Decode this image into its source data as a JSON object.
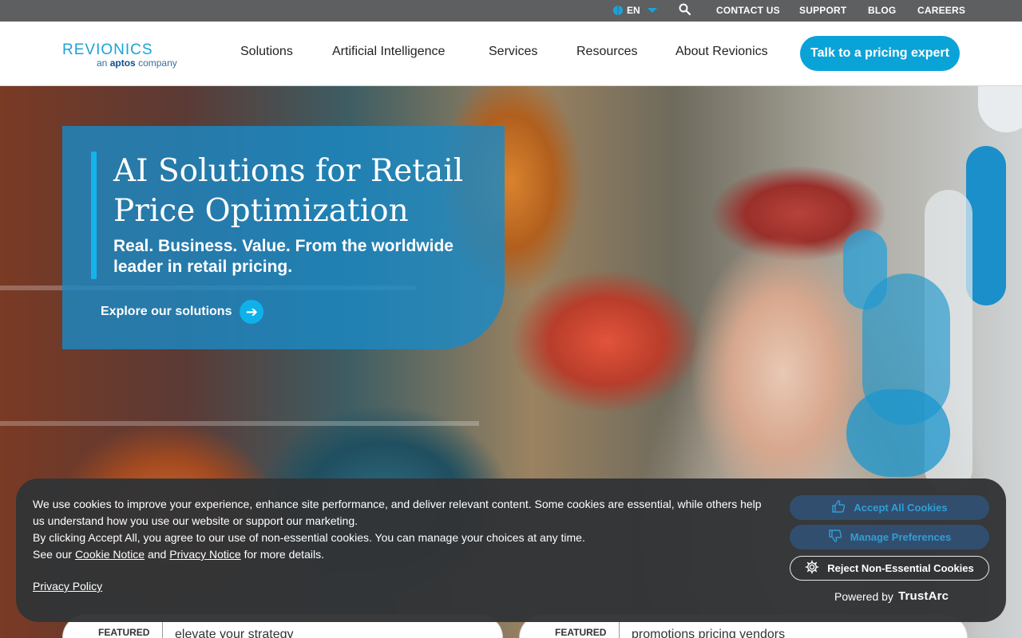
{
  "utility": {
    "language": "EN",
    "links": [
      "CONTACT US",
      "SUPPORT",
      "BLOG",
      "CAREERS"
    ]
  },
  "header": {
    "logo_main": "revionics",
    "logo_sub_prefix": "an",
    "logo_sub_brand": "aptos",
    "logo_sub_suffix": "company",
    "nav": [
      "Solutions",
      "Artificial Intelligence",
      "Services",
      "Resources",
      "About Revionics"
    ],
    "cta": "Talk to a pricing expert"
  },
  "hero": {
    "title": "AI Solutions for Retail Price Optimization",
    "subtitle": "Real. Business. Value. From the worldwide leader in retail pricing.",
    "link": "Explore our solutions"
  },
  "cards": [
    {
      "tag": "FEATURED",
      "text": "elevate your strategy"
    },
    {
      "tag": "FEATURED",
      "text": "promotions pricing vendors"
    }
  ],
  "cookie": {
    "line1": "We use cookies to improve your experience, enhance site performance, and deliver relevant content. Some cookies are essential, while others help us understand how you use our website or support our marketing.",
    "line2": "By clicking Accept All, you agree to our use of non-essential cookies. You can manage your choices at any time.",
    "line3_prefix": "See our",
    "cookie_notice": "Cookie Notice",
    "and": "and",
    "privacy_notice": "Privacy Notice",
    "line3_suffix": "for more details.",
    "privacy_policy": "Privacy Policy",
    "accept": "Accept All Cookies",
    "manage": "Manage Preferences",
    "reject": "Reject Non-Essential Cookies",
    "powered_by": "Powered by",
    "trustarc": "TrustArc"
  },
  "colors": {
    "accent": "#0aa3d8",
    "utility_bar": "#5d5f61",
    "hero_panel": "#1b89c4",
    "cookie_bg": "#323436"
  }
}
